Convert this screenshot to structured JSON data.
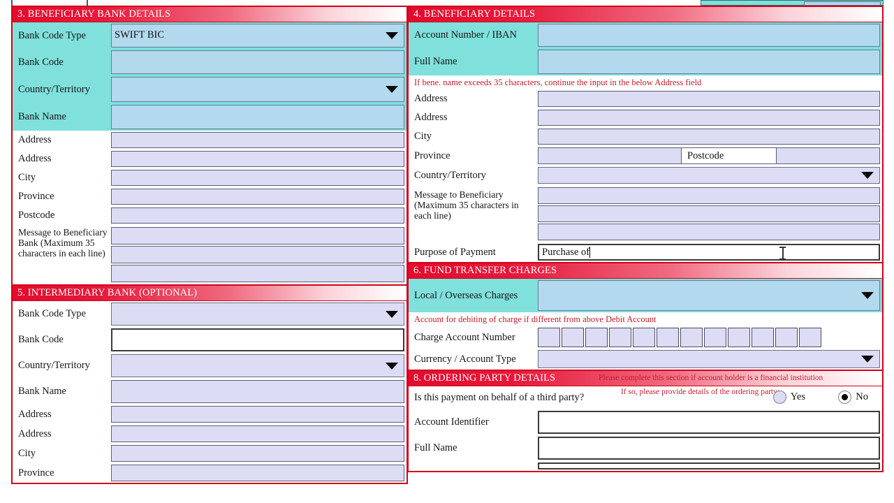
{
  "colors": {
    "header_red": "#e30b2d",
    "panel_border": "#d0021b",
    "teal_label": "#7FE0DC",
    "blue_input": "#B3D9EE",
    "lavender_input": "#DCDCF5",
    "red_note_text": "#c31b2b"
  },
  "section3": {
    "title": "3. BENEFICIARY BANK DETAILS",
    "rows": [
      {
        "label": "Bank Code Type",
        "value": "SWIFT BIC",
        "control": "dropdown"
      },
      {
        "label": "Bank Code",
        "value": "",
        "control": "text"
      },
      {
        "label": "Country/Territory",
        "value": "",
        "control": "dropdown"
      },
      {
        "label": "Bank Name",
        "value": "",
        "control": "text"
      }
    ],
    "address_rows": [
      {
        "label": "Address",
        "value": ""
      },
      {
        "label": "Address",
        "value": ""
      },
      {
        "label": "City",
        "value": ""
      },
      {
        "label": "Province",
        "value": ""
      },
      {
        "label": "Postcode",
        "value": ""
      }
    ],
    "message_label": "Message to Beneficiary Bank (Maximum 35 characters in each line)",
    "message_lines": [
      "",
      "",
      ""
    ]
  },
  "section5": {
    "title": "5. INTERMEDIARY BANK (OPTIONAL)",
    "rows": [
      {
        "label": "Bank Code Type",
        "value": "",
        "control": "dropdown"
      },
      {
        "label": "Bank Code",
        "value": "",
        "control": "text-plain"
      },
      {
        "label": "Country/Territory",
        "value": "",
        "control": "dropdown"
      },
      {
        "label": "Bank Name",
        "value": "",
        "control": "text"
      }
    ],
    "address_rows": [
      {
        "label": "Address",
        "value": ""
      },
      {
        "label": "Address",
        "value": ""
      },
      {
        "label": "City",
        "value": ""
      },
      {
        "label": "Province",
        "value": ""
      }
    ]
  },
  "section4": {
    "title": "4. BENEFICIARY DETAILS",
    "rows": [
      {
        "label": "Account Number / IBAN",
        "value": ""
      },
      {
        "label": "Full Name",
        "value": ""
      }
    ],
    "note": "If bene. name exceeds 35 characters, continue the input in the below Address field",
    "address_rows": [
      {
        "label": "Address",
        "value": ""
      },
      {
        "label": "Address",
        "value": ""
      },
      {
        "label": "City",
        "value": ""
      }
    ],
    "province_label": "Province",
    "province_value": "",
    "postcode_label": "Postcode",
    "postcode_value": "",
    "country_label": "Country/Territory",
    "country_value": "",
    "message_label": "Message to Beneficiary (Maximum 35 characters in each line)",
    "message_lines": [
      "",
      "",
      ""
    ],
    "purpose_label": "Purpose of Payment",
    "purpose_value": "Purchase of"
  },
  "section6": {
    "title": "6. FUND TRANSFER CHARGES",
    "charges_label": "Local / Overseas Charges",
    "charges_value": "",
    "note": "Account for debiting of charge if different from above Debit Account",
    "charge_account_label": "Charge Account Number",
    "charge_account_boxes": [
      "",
      "",
      "",
      "",
      "",
      "",
      "",
      "",
      "",
      "",
      "",
      ""
    ],
    "currency_label": "Currency / Account Type",
    "currency_value": ""
  },
  "section8": {
    "title": "8. ORDERING PARTY DETAILS",
    "header_note": "Please complete this section if account holder is a financial institution",
    "question": "Is this payment on behalf of a third party?",
    "question_note": "If so, please provide details of the ordering party:",
    "radio_yes": "Yes",
    "radio_no": "No",
    "selected": "No",
    "rows": [
      {
        "label": "Account Identifier",
        "value": ""
      },
      {
        "label": "Full Name",
        "value": ""
      }
    ]
  }
}
